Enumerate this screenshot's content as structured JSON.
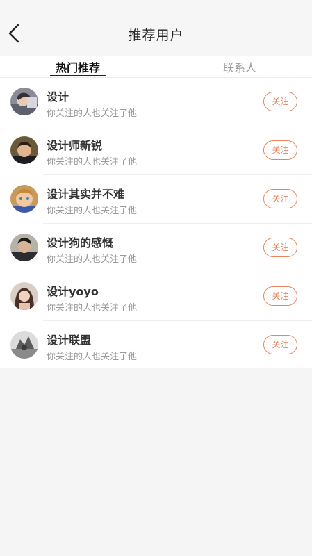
{
  "header": {
    "title": "推荐用户",
    "back_icon": "chevron-left-icon"
  },
  "tabs": [
    {
      "label": "热门推荐",
      "active": true
    },
    {
      "label": "联系人",
      "active": false
    }
  ],
  "users": [
    {
      "name": "设计",
      "subtitle": "你关注的人也关注了他",
      "follow_label": "关注",
      "avatar": "avatar-1"
    },
    {
      "name": "设计师新锐",
      "subtitle": "你关注的人也关注了他",
      "follow_label": "关注",
      "avatar": "avatar-2"
    },
    {
      "name": "设计其实并不难",
      "subtitle": "你关注的人也关注了他",
      "follow_label": "关注",
      "avatar": "avatar-3"
    },
    {
      "name": "设计狗的感慨",
      "subtitle": "你关注的人也关注了他",
      "follow_label": "关注",
      "avatar": "avatar-4"
    },
    {
      "name": "设计yoyo",
      "subtitle": "你关注的人也关注了他",
      "follow_label": "关注",
      "avatar": "avatar-5"
    },
    {
      "name": "设计联盟",
      "subtitle": "你关注的人也关注了他",
      "follow_label": "关注",
      "avatar": "avatar-6"
    }
  ],
  "colors": {
    "accent": "#e8845a",
    "background": "#f5f5f5"
  }
}
